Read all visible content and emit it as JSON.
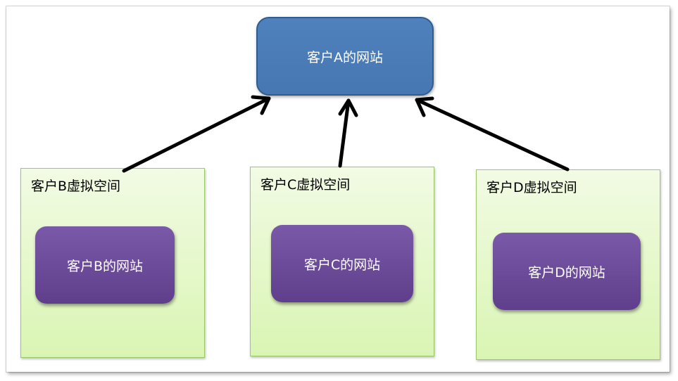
{
  "main_site": {
    "label": "客户A的网站"
  },
  "spaces": [
    {
      "label": "客户B虚拟空间",
      "site_label": "客户B的网站"
    },
    {
      "label": "客户C虚拟空间",
      "site_label": "客户C的网站"
    },
    {
      "label": "客户D虚拟空间",
      "site_label": "客户D的网站"
    }
  ],
  "colors": {
    "main_site_fill": "#4f81bd",
    "space_fill": "#e6f8c8",
    "site_fill": "#6b4c9a",
    "arrow": "#000000"
  }
}
